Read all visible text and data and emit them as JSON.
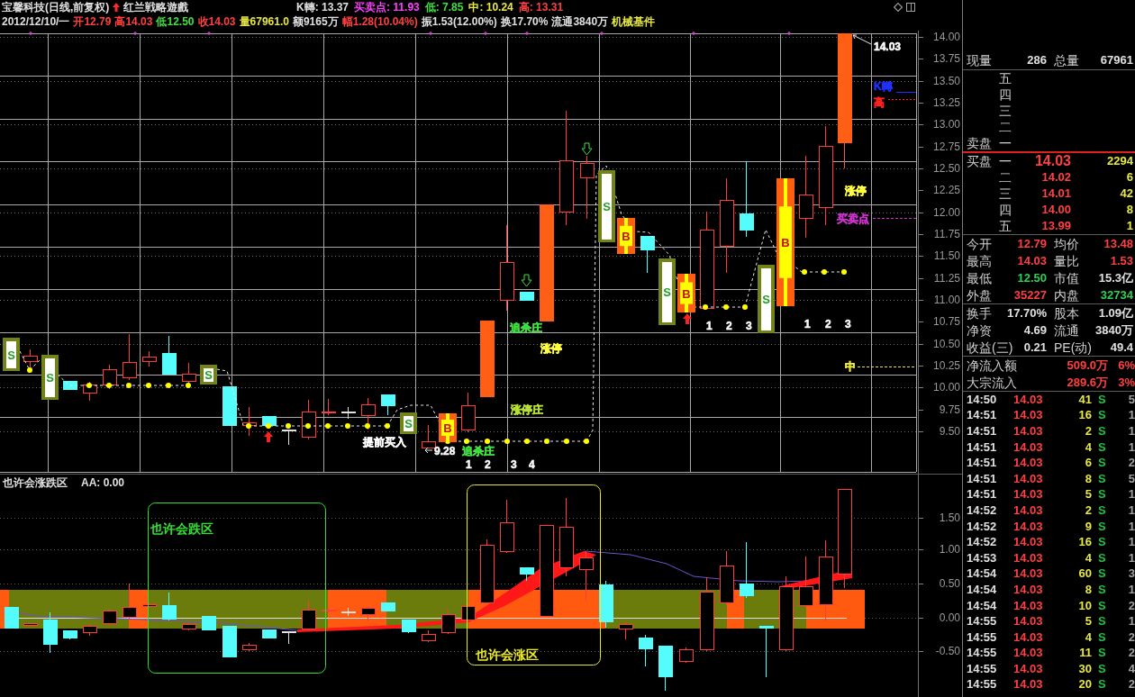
{
  "header": {
    "title": "宝馨科技(日线,前复权)",
    "formula": "红兰戦略遊戲",
    "indicators": [
      {
        "text": "K轉: 13.37",
        "color": "#e0e0e0"
      },
      {
        "text": "买卖点: 11.93",
        "color": "#ff40ff"
      },
      {
        "text": "低: 7.85",
        "color": "#40e040"
      },
      {
        "text": "中: 10.24",
        "color": "#e8e840"
      },
      {
        "text": "高: 13.31",
        "color": "#ff4040"
      }
    ],
    "quote": [
      {
        "text": "2012/12/10/一",
        "color": "#e0e0e0"
      },
      {
        "text": "开12.79",
        "color": "#ff4040"
      },
      {
        "text": "高14.03",
        "color": "#ff4040"
      },
      {
        "text": "低12.50",
        "color": "#40e040"
      },
      {
        "text": "收14.03",
        "color": "#ff4040"
      },
      {
        "text": "量67961.0",
        "color": "#e8e840"
      },
      {
        "text": "额9165万",
        "color": "#e0e0e0"
      },
      {
        "text": "幅1.28(10.04%)",
        "color": "#ff4040"
      },
      {
        "text": "振1.53(12.00%)",
        "color": "#e0e0e0"
      },
      {
        "text": "换17.70%",
        "color": "#e0e0e0"
      },
      {
        "text": "流通3840万",
        "color": "#e0e0e0"
      },
      {
        "text": "机械基件",
        "color": "#e8e840"
      }
    ]
  },
  "main_chart": {
    "price_axis": [
      "14.00",
      "13.75",
      "13.50",
      "13.25",
      "13.00",
      "12.75",
      "12.50",
      "12.25",
      "12.00",
      "11.75",
      "11.50",
      "11.25",
      "11.00",
      "10.75",
      "10.50",
      "10.25",
      "10.00",
      "9.75",
      "9.50"
    ],
    "signals": [
      {
        "kind": "sell",
        "label": "S"
      },
      {
        "kind": "sell",
        "label": "S"
      },
      {
        "kind": "sell",
        "label": "S"
      },
      {
        "kind": "sell",
        "label": "S"
      },
      {
        "kind": "buy",
        "label": "B"
      },
      {
        "kind": "sell",
        "label": "S"
      },
      {
        "kind": "buy",
        "label": "B"
      },
      {
        "kind": "sell",
        "label": "S"
      },
      {
        "kind": "buy",
        "label": "B"
      },
      {
        "kind": "sell",
        "label": "S"
      },
      {
        "kind": "buy",
        "label": "B"
      }
    ],
    "annotations": [
      {
        "text": "14.03",
        "color": "#ffffff"
      },
      {
        "text": "涨停",
        "color": "#ffff40"
      },
      {
        "text": "追杀庄",
        "color": "#40e040"
      },
      {
        "text": "1",
        "color": "#ffffff"
      },
      {
        "text": "2",
        "color": "#ffffff"
      },
      {
        "text": "3",
        "color": "#ffffff"
      },
      {
        "text": "1",
        "color": "#ffffff"
      },
      {
        "text": "2",
        "color": "#ffffff"
      },
      {
        "text": "3",
        "color": "#ffffff"
      },
      {
        "text": "涨停",
        "color": "#ffff40"
      },
      {
        "text": "涨停庄",
        "color": "#b8e030"
      },
      {
        "text": "提前买入",
        "color": "#ffffff"
      },
      {
        "text": "9.28",
        "color": "#ffffff"
      },
      {
        "text": "追杀庄",
        "color": "#40e040"
      },
      {
        "text": "1",
        "color": "#ffffff"
      },
      {
        "text": "2",
        "color": "#ffffff"
      },
      {
        "text": "3",
        "color": "#ffffff"
      },
      {
        "text": "4",
        "color": "#ffffff"
      }
    ],
    "levels": [
      {
        "label": "K轉",
        "color": "#2030ff"
      },
      {
        "label": "高",
        "color": "#ff2020"
      },
      {
        "label": "买卖点",
        "color": "#d030d0"
      },
      {
        "label": "中",
        "color": "#e8e840"
      }
    ]
  },
  "sub_chart": {
    "title": "也许会涨跌区",
    "value": "AA: 0.00",
    "axis": [
      "1.50",
      "1.00",
      "0.50",
      "0.00",
      "-0.50"
    ],
    "zones": [
      {
        "label": "也许会跌区",
        "color": "#30e030"
      },
      {
        "label": "也许会涨区",
        "color": "#e8e830"
      }
    ]
  },
  "panel": {
    "volume": [
      {
        "label": "现量",
        "value": "286"
      },
      {
        "label": "总量",
        "value": "67961"
      }
    ],
    "asks": {
      "label": "卖盘",
      "levels": [
        "五",
        "四",
        "三",
        "二",
        "一"
      ]
    },
    "bids": {
      "label": "买盘",
      "rows": [
        {
          "level": "一",
          "price": "14.03",
          "volume": "2294"
        },
        {
          "level": "二",
          "price": "14.02",
          "volume": "6"
        },
        {
          "level": "三",
          "price": "14.01",
          "volume": "42"
        },
        {
          "level": "四",
          "price": "14.00",
          "volume": "8"
        },
        {
          "level": "五",
          "price": "13.99",
          "volume": "1"
        }
      ]
    },
    "stats": [
      {
        "label": "今开",
        "value": "12.79",
        "color": "#ff4040"
      },
      {
        "label": "均价",
        "value": "13.48",
        "color": "#ff4040"
      },
      {
        "label": "最高",
        "value": "14.03",
        "color": "#ff4040"
      },
      {
        "label": "量比",
        "value": "1.53",
        "color": "#ff4040"
      },
      {
        "label": "最低",
        "value": "12.50",
        "color": "#30d050"
      },
      {
        "label": "市值",
        "value": "15.3亿",
        "color": "#e0e0e0"
      },
      {
        "label": "外盘",
        "value": "35227",
        "color": "#ff4040"
      },
      {
        "label": "内盘",
        "value": "32734",
        "color": "#30d050"
      }
    ],
    "fundamentals": [
      {
        "label": "换手",
        "value": "17.70%"
      },
      {
        "label": "股本",
        "value": "1.09亿"
      },
      {
        "label": "净资",
        "value": "4.69"
      },
      {
        "label": "流通",
        "value": "3840万"
      },
      {
        "label": "收益(三)",
        "value": "0.21"
      },
      {
        "label": "PE(动)",
        "value": "49.4"
      }
    ],
    "flows": [
      {
        "label": "净流入额",
        "value": "509.0万",
        "share": "6%"
      },
      {
        "label": "大宗流入",
        "value": "289.6万",
        "share": "3%"
      }
    ],
    "ticks": [
      {
        "time": "14:50",
        "price": "14.03",
        "volume": "41",
        "side": "S",
        "column_5": "5"
      },
      {
        "time": "14:51",
        "price": "14.03",
        "volume": "16",
        "side": "S",
        "column_5": "1"
      },
      {
        "time": "14:51",
        "price": "14.03",
        "volume": "2",
        "side": "S",
        "column_5": "1"
      },
      {
        "time": "14:51",
        "price": "14.03",
        "volume": "4",
        "side": "S",
        "column_5": "1"
      },
      {
        "time": "14:51",
        "price": "14.03",
        "volume": "6",
        "side": "S",
        "column_5": "2"
      },
      {
        "time": "14:51",
        "price": "14.03",
        "volume": "8",
        "side": "S",
        "column_5": "5"
      },
      {
        "time": "14:51",
        "price": "14.03",
        "volume": "5",
        "side": "S",
        "column_5": "1"
      },
      {
        "time": "14:52",
        "price": "14.03",
        "volume": "2",
        "side": "S",
        "column_5": "1"
      },
      {
        "time": "14:52",
        "price": "14.03",
        "volume": "9",
        "side": "S",
        "column_5": "1"
      },
      {
        "time": "14:52",
        "price": "14.03",
        "volume": "16",
        "side": "S",
        "column_5": "1"
      },
      {
        "time": "14:53",
        "price": "14.03",
        "volume": "4",
        "side": "S",
        "column_5": "1"
      },
      {
        "time": "14:54",
        "price": "14.03",
        "volume": "60",
        "side": "S",
        "column_5": "3"
      },
      {
        "time": "14:54",
        "price": "14.03",
        "volume": "8",
        "side": "S",
        "column_5": "1"
      },
      {
        "time": "14:54",
        "price": "14.03",
        "volume": "10",
        "side": "S",
        "column_5": "2"
      },
      {
        "time": "14:55",
        "price": "14.03",
        "volume": "5",
        "side": "S",
        "column_5": "1"
      },
      {
        "time": "14:55",
        "price": "14.03",
        "volume": "4",
        "side": "S",
        "column_5": "2"
      },
      {
        "time": "14:55",
        "price": "14.03",
        "volume": "11",
        "side": "S",
        "column_5": "2"
      },
      {
        "time": "14:55",
        "price": "14.03",
        "volume": "30",
        "side": "S",
        "column_5": "4"
      },
      {
        "time": "14:55",
        "price": "14.03",
        "volume": "20",
        "side": "S",
        "column_5": "2"
      }
    ]
  }
}
